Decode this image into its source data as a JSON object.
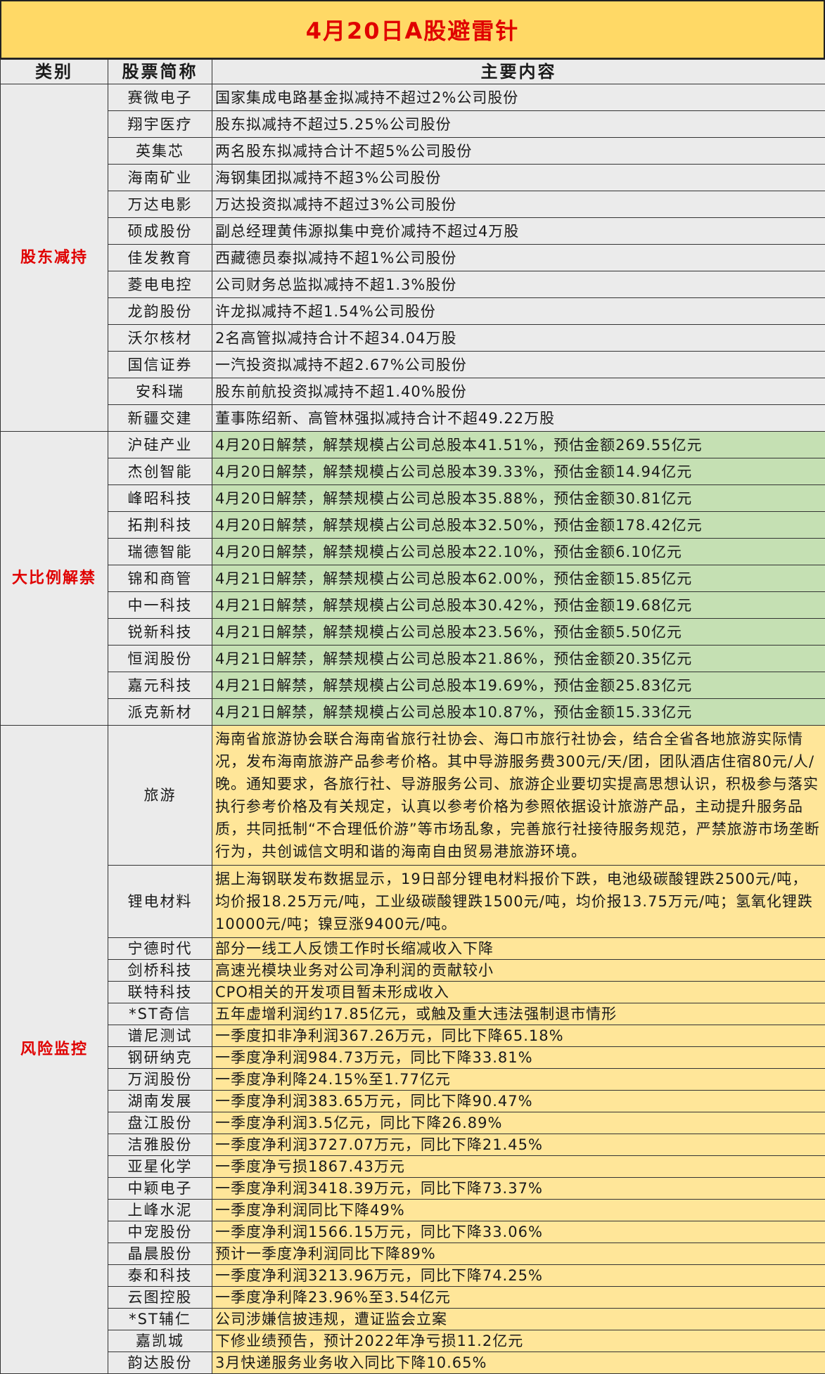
{
  "title": "4月20日A股避雷针",
  "headers": {
    "category": "类别",
    "stock": "股票简称",
    "content": "主要内容"
  },
  "sections": [
    {
      "category": "股东减持",
      "rows": [
        {
          "name": "赛微电子",
          "content": "国家集成电路基金拟减持不超过2%公司股份"
        },
        {
          "name": "翔宇医疗",
          "content": "股东拟减持不超过5.25%公司股份"
        },
        {
          "name": "英集芯",
          "content": "两名股东拟减持合计不超5%公司股份"
        },
        {
          "name": "海南矿业",
          "content": "海钢集团拟减持不超3%公司股份"
        },
        {
          "name": "万达电影",
          "content": "万达投资拟减持不超过3%公司股份"
        },
        {
          "name": "硕成股份",
          "content": "副总经理黄伟源拟集中竞价减持不超过4万股"
        },
        {
          "name": "佳发教育",
          "content": "西藏德员泰拟减持不超1%公司股份"
        },
        {
          "name": "菱电电控",
          "content": "公司财务总监拟减持不超1.3%股份"
        },
        {
          "name": "龙韵股份",
          "content": "许龙拟减持不超1.54%公司股份"
        },
        {
          "name": "沃尔核材",
          "content": "2名高管拟减持合计不超34.04万股"
        },
        {
          "name": "国信证券",
          "content": "一汽投资拟减持不超2.67%公司股份"
        },
        {
          "name": "安科瑞",
          "content": "股东前航投资拟减持不超1.40%股份"
        },
        {
          "name": "新疆交建",
          "content": "董事陈绍新、高管林强拟减持合计不超49.22万股"
        }
      ]
    },
    {
      "category": "大比例解禁",
      "rows": [
        {
          "name": "沪硅产业",
          "content": "4月20日解禁，解禁规模占公司总股本41.51%，预估金额269.55亿元"
        },
        {
          "name": "杰创智能",
          "content": "4月20日解禁，解禁规模占公司总股本39.33%，预估金额14.94亿元"
        },
        {
          "name": "峰昭科技",
          "content": "4月20日解禁，解禁规模占公司总股本35.88%，预估金额30.81亿元"
        },
        {
          "name": "拓荆科技",
          "content": "4月20日解禁，解禁规模占公司总股本32.50%，预估金额178.42亿元"
        },
        {
          "name": "瑞德智能",
          "content": "4月20日解禁，解禁规模占公司总股本22.10%，预估金额6.10亿元"
        },
        {
          "name": "锦和商管",
          "content": "4月21日解禁，解禁规模占公司总股本62.00%，预估金额15.85亿元"
        },
        {
          "name": "中一科技",
          "content": "4月21日解禁，解禁规模占公司总股本30.42%，预估金额19.68亿元"
        },
        {
          "name": "锐新科技",
          "content": "4月21日解禁，解禁规模占公司总股本23.56%，预估金额5.50亿元"
        },
        {
          "name": "恒润股份",
          "content": "4月21日解禁，解禁规模占公司总股本21.86%，预估金额20.35亿元"
        },
        {
          "name": "嘉元科技",
          "content": "4月21日解禁，解禁规模占公司总股本19.69%，预估金额25.83亿元"
        },
        {
          "name": "派克新材",
          "content": "4月21日解禁，解禁规模占公司总股本10.87%，预估金额15.33亿元"
        }
      ]
    },
    {
      "category": "风险监控",
      "rows": [
        {
          "name": "旅游",
          "content": "海南省旅游协会联合海南省旅行社协会、海口市旅行社协会，结合全省各地旅游实际情况，发布海南旅游产品参考价格。其中导游服务费300元/天/团，团队酒店住宿80元/人/晚。通知要求，各旅行社、导游服务公司、旅游企业要切实提高思想认识，积极参与落实执行参考价格及有关规定，认真以参考价格为参照依据设计旅游产品，主动提升服务品质，共同抵制“不合理低价游”等市场乱象，完善旅行社接待服务规范，严禁旅游市场垄断行为，共创诚信文明和谐的海南自由贸易港旅游环境。",
          "wrap": true
        },
        {
          "name": "锂电材料",
          "content": "据上海钢联发布数据显示，19日部分锂电材料报价下跌，电池级碳酸锂跌2500元/吨，均价报18.25万元/吨，工业级碳酸锂跌1500元/吨，均价报13.75万元/吨；氢氧化锂跌10000元/吨；镍豆涨9400元/吨。",
          "wrap": true
        },
        {
          "name": "宁德时代",
          "content": "部分一线工人反馈工作时长缩减收入下降"
        },
        {
          "name": "剑桥科技",
          "content": "高速光模块业务对公司净利润的贡献较小"
        },
        {
          "name": "联特科技",
          "content": "CPO相关的开发项目暂未形成收入"
        },
        {
          "name": "*ST奇信",
          "content": "五年虚增利润约17.85亿元，或触及重大违法强制退市情形"
        },
        {
          "name": "谱尼测试",
          "content": "一季度扣非净利润367.26万元，同比下降65.18%"
        },
        {
          "name": "钢研纳克",
          "content": "一季度净利润984.73万元，同比下降33.81%"
        },
        {
          "name": "万润股份",
          "content": "一季度净利降24.15%至1.77亿元"
        },
        {
          "name": "湖南发展",
          "content": "一季度净利润383.65万元，同比下降90.47%"
        },
        {
          "name": "盘江股份",
          "content": "一季度净利润3.5亿元，同比下降26.89%"
        },
        {
          "name": "洁雅股份",
          "content": "一季度净利润3727.07万元，同比下降21.45%"
        },
        {
          "name": "亚星化学",
          "content": "一季度净亏损1867.43万元"
        },
        {
          "name": "中颖电子",
          "content": "一季度净利润3418.39万元，同比下降73.37%"
        },
        {
          "name": "上峰水泥",
          "content": "一季度净利润同比下降49%"
        },
        {
          "name": "中宠股份",
          "content": "一季度净利润1566.15万元，同比下降33.06%"
        },
        {
          "name": "晶晨股份",
          "content": "预计一季度净利润同比下降89%"
        },
        {
          "name": "泰和科技",
          "content": "一季度净利润3213.96万元，同比下降74.25%"
        },
        {
          "name": "云图控股",
          "content": "一季度净利降23.96%至3.54亿元"
        },
        {
          "name": "*ST辅仁",
          "content": "公司涉嫌信披违规，遭证监会立案"
        },
        {
          "name": "嘉凯城",
          "content": "下修业绩预告，预计2022年净亏损11.2亿元"
        },
        {
          "name": "韵达股份",
          "content": "3月快递服务业务收入同比下降10.65%"
        }
      ]
    }
  ]
}
